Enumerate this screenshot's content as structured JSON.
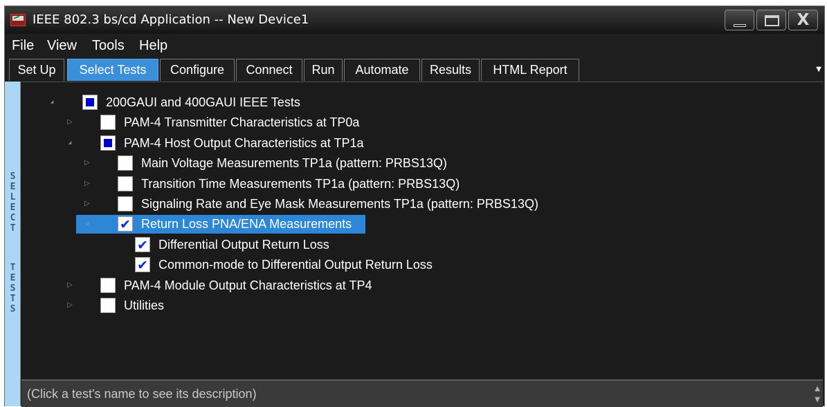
{
  "window": {
    "title": "IEEE 802.3 bs/cd Application -- New Device1",
    "minimize_icon": "minimize-icon",
    "maximize_icon": "maximize-icon",
    "close_glyph": "X"
  },
  "menu": [
    "File",
    "View",
    "Tools",
    "Help"
  ],
  "tabs": [
    {
      "label": "Set Up",
      "active": false
    },
    {
      "label": "Select Tests",
      "active": true
    },
    {
      "label": "Configure",
      "active": false
    },
    {
      "label": "Connect",
      "active": false
    },
    {
      "label": "Run",
      "active": false
    },
    {
      "label": "Automate",
      "active": false
    },
    {
      "label": "Results",
      "active": false
    },
    {
      "label": "HTML Report",
      "active": false
    }
  ],
  "tab_overflow_icon": "chevron-down-icon",
  "side_label": {
    "word1": "SELECT",
    "word2": "TESTS"
  },
  "tree": [
    {
      "label": "200GAUI and 400GAUI IEEE Tests",
      "level": 0,
      "expander": "expanded",
      "state": "partial"
    },
    {
      "label": "PAM-4 Transmitter Characteristics at TP0a",
      "level": 1,
      "expander": "collapsed",
      "state": "unchecked"
    },
    {
      "label": "PAM-4 Host Output Characteristics at TP1a",
      "level": 1,
      "expander": "expanded",
      "state": "partial"
    },
    {
      "label": "Main Voltage Measurements TP1a (pattern: PRBS13Q)",
      "level": 2,
      "expander": "collapsed",
      "state": "unchecked"
    },
    {
      "label": "Transition Time Measurements TP1a (pattern: PRBS13Q)",
      "level": 2,
      "expander": "collapsed",
      "state": "unchecked"
    },
    {
      "label": "Signaling Rate and Eye Mask Measurements TP1a (pattern: PRBS13Q)",
      "level": 2,
      "expander": "collapsed",
      "state": "unchecked"
    },
    {
      "label": "Return Loss PNA/ENA Measurements",
      "level": 2,
      "expander": "expanded",
      "state": "checked",
      "selected": true
    },
    {
      "label": "Differential Output Return Loss",
      "level": 3,
      "expander": "none",
      "state": "checked"
    },
    {
      "label": "Common-mode to Differential Output Return Loss",
      "level": 3,
      "expander": "none",
      "state": "checked"
    },
    {
      "label": "PAM-4 Module Output Characteristics at TP4",
      "level": 1,
      "expander": "collapsed",
      "state": "unchecked"
    },
    {
      "label": "Utilities",
      "level": 1,
      "expander": "collapsed",
      "state": "unchecked"
    }
  ],
  "description": "(Click a test's name to see its description)",
  "colors": {
    "accent": "#2d86d6",
    "active_tab": "#3b8fd9",
    "side_label_bg": "#aad7f5",
    "checkbox_mark": "#0a2be0"
  }
}
